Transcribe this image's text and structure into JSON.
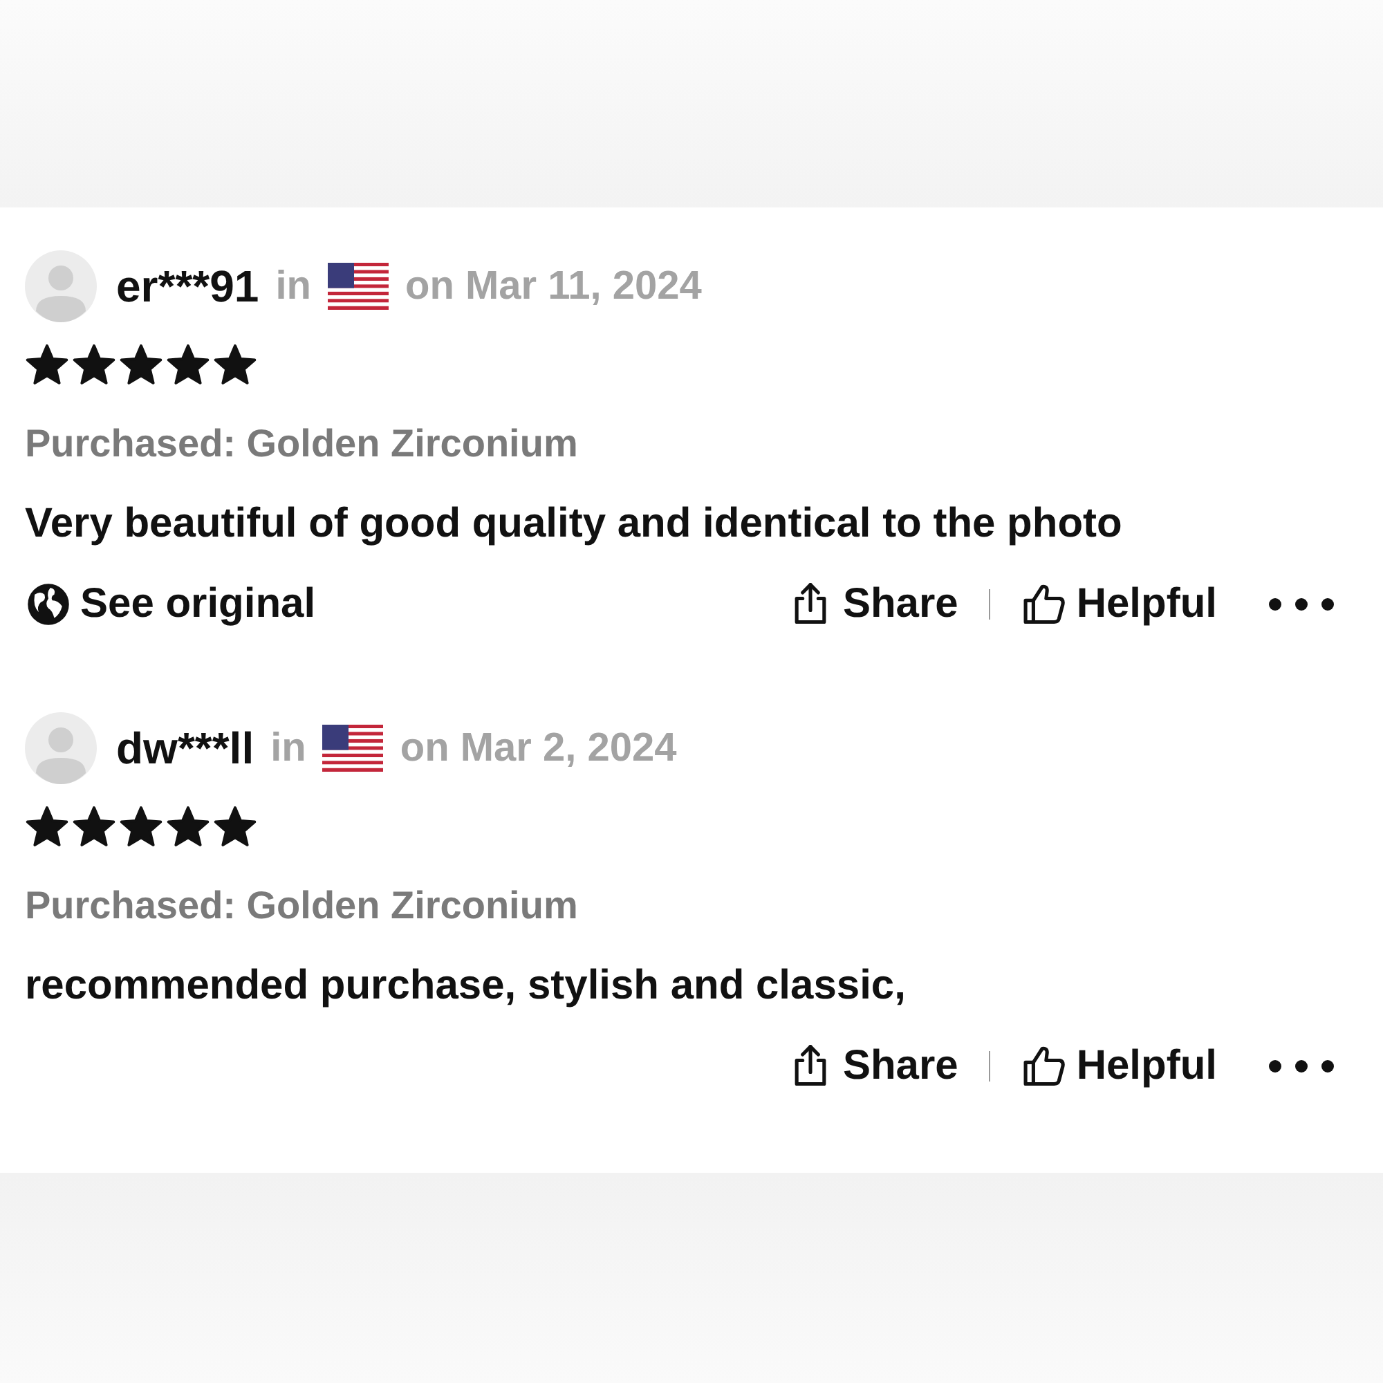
{
  "reviews": [
    {
      "user": "er***91",
      "in_label": "in",
      "date": "on Mar 11, 2024",
      "stars": 5,
      "purchased": "Purchased: Golden Zirconium",
      "text": "Very beautiful of good quality and identical to the photo",
      "see_original": "See original",
      "share": "Share",
      "helpful": "Helpful"
    },
    {
      "user": "dw***ll",
      "in_label": "in",
      "date": "on Mar 2, 2024",
      "stars": 5,
      "purchased": "Purchased: Golden Zirconium",
      "text": "recommended purchase, stylish and classic,",
      "share": "Share",
      "helpful": "Helpful"
    }
  ]
}
